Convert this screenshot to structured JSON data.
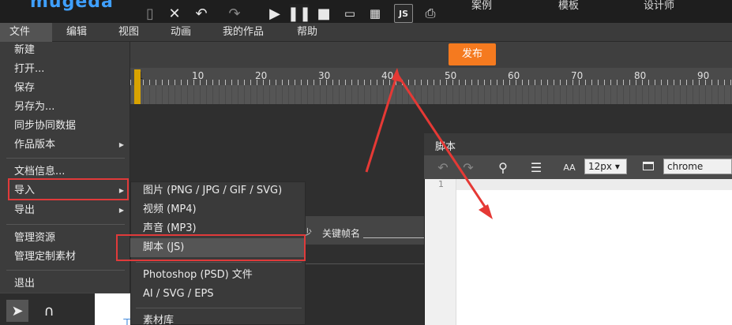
{
  "brand": {
    "logo": "mugeda",
    "nav": [
      "案例",
      "模板",
      "设计师"
    ]
  },
  "menubar": [
    "文件",
    "编辑",
    "视图",
    "动画",
    "我的作品",
    "帮助"
  ],
  "toolbar": {
    "publish_label": "发布",
    "js_label": "JS"
  },
  "ruler": {
    "labels": [
      "1",
      "10",
      "20",
      "30",
      "40",
      "50",
      "60",
      "70",
      "80",
      "90"
    ]
  },
  "file_menu": {
    "items": [
      {
        "label": "新建",
        "submenu": false
      },
      {
        "label": "打开...",
        "submenu": false
      },
      {
        "label": "保存",
        "submenu": false
      },
      {
        "label": "另存为...",
        "submenu": false
      },
      {
        "label": "同步协同数据",
        "submenu": false
      },
      {
        "label": "作品版本",
        "submenu": true
      },
      {
        "label": "文档信息...",
        "submenu": false
      },
      {
        "label": "导入",
        "submenu": true
      },
      {
        "label": "导出",
        "submenu": true
      },
      {
        "label": "管理资源",
        "submenu": false
      },
      {
        "label": "管理定制素材",
        "submenu": false
      },
      {
        "label": "退出",
        "submenu": false
      }
    ]
  },
  "import_submenu": {
    "items": [
      "图片 (PNG / JPG / GIF / SVG)",
      "视频 (MP4)",
      "声音 (MP3)",
      "脚本 (JS)",
      "Photoshop (PSD) 文件",
      "AI / SVG / EPS",
      "素材库"
    ]
  },
  "properties": {
    "keyframe_label": "关键帧名",
    "arrow_glyph": "少"
  },
  "script_panel": {
    "title": "脚本",
    "font_size": "12px",
    "theme": "chrome",
    "line_number": "1",
    "font_icon_label": "AA"
  },
  "canvas_peek_text": "工",
  "colors": {
    "accent": "#f57a1f",
    "highlight_border": "#e03a3a",
    "playhead": "#d9a300"
  }
}
